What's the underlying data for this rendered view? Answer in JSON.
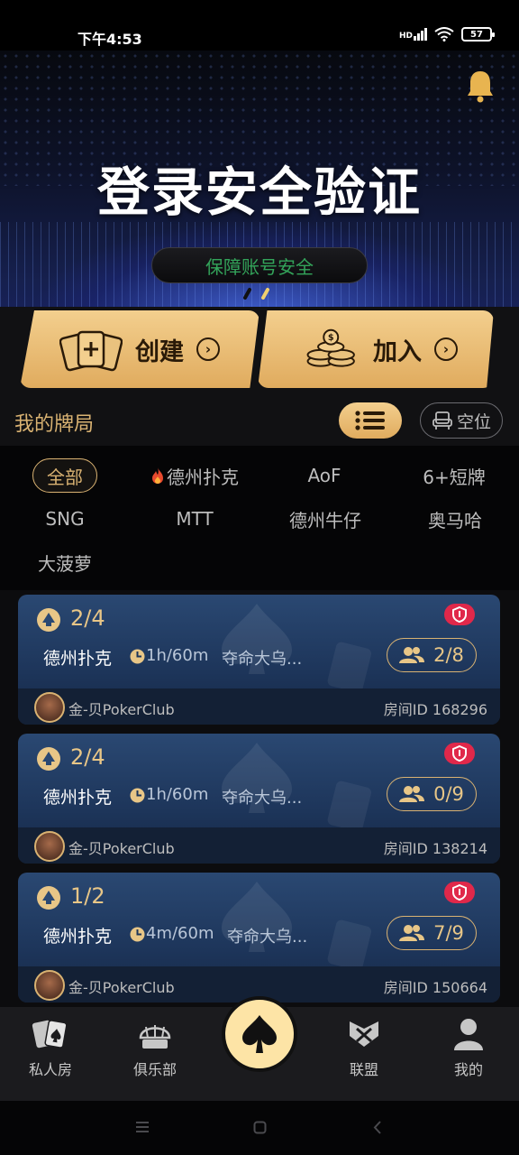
{
  "status_bar": {
    "time": "下午4:53",
    "network": "HD",
    "battery": "57"
  },
  "banner": {
    "title": "登录安全验证",
    "subtitle": "保障账号安全"
  },
  "actions": {
    "create_label": "创建",
    "join_label": "加入"
  },
  "my_games": {
    "title": "我的牌局",
    "vacant_label": "空位"
  },
  "filters": [
    {
      "label": "全部",
      "active": true
    },
    {
      "label": "德州扑克",
      "icon": "fire-icon"
    },
    {
      "label": "AoF"
    },
    {
      "label": "6+短牌"
    },
    {
      "label": "SNG"
    },
    {
      "label": "MTT"
    },
    {
      "label": "德州牛仔"
    },
    {
      "label": "奥马哈"
    },
    {
      "label": "大菠萝"
    }
  ],
  "rooms": [
    {
      "blinds": "2/4",
      "game": "德州扑克",
      "duration": "1h/60m",
      "name": "夺命大乌...",
      "players": "2/8",
      "club": "金-贝PokerClub",
      "room_id_label": "房间ID",
      "room_id": "168296"
    },
    {
      "blinds": "2/4",
      "game": "德州扑克",
      "duration": "1h/60m",
      "name": "夺命大乌...",
      "players": "0/9",
      "club": "金-贝PokerClub",
      "room_id_label": "房间ID",
      "room_id": "138214"
    },
    {
      "blinds": "1/2",
      "game": "德州扑克",
      "duration": "4m/60m",
      "name": "夺命大乌...",
      "players": "7/9",
      "club": "金-贝PokerClub",
      "room_id_label": "房间ID",
      "room_id": "150664"
    }
  ],
  "nav": {
    "items": [
      {
        "label": "私人房",
        "icon": "private-room-icon"
      },
      {
        "label": "俱乐部",
        "icon": "club-icon"
      },
      {
        "label": "",
        "icon": "spade-icon"
      },
      {
        "label": "联盟",
        "icon": "alliance-icon"
      },
      {
        "label": "我的",
        "icon": "profile-icon"
      }
    ]
  },
  "colors": {
    "gold": "#d9b272",
    "gold_light": "#f3cf8e",
    "card_blue": "#1d355a",
    "badge_red": "#e0284a",
    "green_text": "#33a45a"
  }
}
